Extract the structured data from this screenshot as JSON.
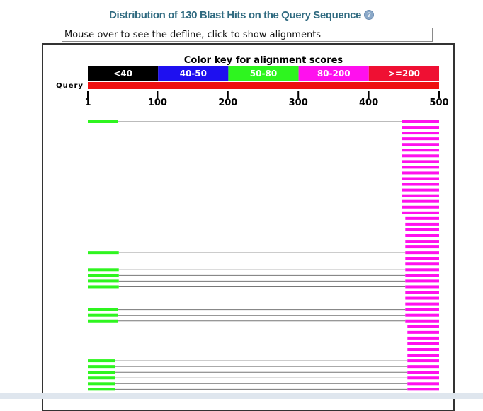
{
  "header": {
    "title": "Distribution of 130 Blast Hits on the Query Sequence",
    "help_icon": "question-circle-icon"
  },
  "defline": {
    "text": "Mouse over to see the defline, click to show alignments"
  },
  "chart_data": {
    "type": "alignment-graphic",
    "title": "Color key for alignment scores",
    "query_label": "Query",
    "query_range": [
      1,
      500
    ],
    "ticks": [
      "1",
      "100",
      "200",
      "300",
      "400",
      "500"
    ],
    "tick_values": [
      1,
      100,
      200,
      300,
      400,
      500
    ],
    "color_key": [
      {
        "label": "<40",
        "color": "#000000"
      },
      {
        "label": "40-50",
        "color": "#1e10f0"
      },
      {
        "label": "50-80",
        "color": "#2ef51f"
      },
      {
        "label": "80-200",
        "color": "#ff10ee"
      },
      {
        "label": ">=200",
        "color": "#ef1033"
      }
    ],
    "query_bar_color": "#ee1010",
    "connector_color": "#777777",
    "hits": [
      {
        "segments": [
          [
            1,
            44,
            "50-80"
          ],
          [
            447,
            500,
            "80-200"
          ]
        ]
      },
      {
        "segments": [
          [
            447,
            500,
            "80-200"
          ]
        ]
      },
      {
        "segments": [
          [
            447,
            500,
            "80-200"
          ]
        ]
      },
      {
        "segments": [
          [
            447,
            500,
            "80-200"
          ]
        ]
      },
      {
        "segments": [
          [
            447,
            500,
            "80-200"
          ]
        ]
      },
      {
        "segments": [
          [
            447,
            500,
            "80-200"
          ]
        ]
      },
      {
        "segments": [
          [
            447,
            500,
            "80-200"
          ]
        ]
      },
      {
        "segments": [
          [
            447,
            500,
            "80-200"
          ]
        ]
      },
      {
        "segments": [
          [
            447,
            500,
            "80-200"
          ]
        ]
      },
      {
        "segments": [
          [
            447,
            500,
            "80-200"
          ]
        ]
      },
      {
        "segments": [
          [
            447,
            500,
            "80-200"
          ]
        ]
      },
      {
        "segments": [
          [
            447,
            500,
            "80-200"
          ]
        ]
      },
      {
        "segments": [
          [
            447,
            500,
            "80-200"
          ]
        ]
      },
      {
        "segments": [
          [
            447,
            500,
            "80-200"
          ]
        ]
      },
      {
        "segments": [
          [
            447,
            500,
            "80-200"
          ]
        ]
      },
      {
        "segments": [
          [
            447,
            500,
            "80-200"
          ]
        ]
      },
      {
        "segments": [
          [
            447,
            500,
            "80-200"
          ]
        ]
      },
      {
        "segments": [
          [
            452,
            500,
            "80-200"
          ]
        ]
      },
      {
        "segments": [
          [
            452,
            500,
            "80-200"
          ]
        ]
      },
      {
        "segments": [
          [
            452,
            500,
            "80-200"
          ]
        ]
      },
      {
        "segments": [
          [
            452,
            500,
            "80-200"
          ]
        ]
      },
      {
        "segments": [
          [
            452,
            500,
            "80-200"
          ]
        ]
      },
      {
        "segments": [
          [
            452,
            500,
            "80-200"
          ]
        ]
      },
      {
        "segments": [
          [
            1,
            45,
            "50-80"
          ],
          [
            452,
            500,
            "80-200"
          ]
        ]
      },
      {
        "segments": [
          [
            452,
            500,
            "80-200"
          ]
        ]
      },
      {
        "segments": [
          [
            452,
            500,
            "80-200"
          ]
        ]
      },
      {
        "segments": [
          [
            1,
            45,
            "50-80"
          ],
          [
            452,
            500,
            "80-200"
          ]
        ]
      },
      {
        "segments": [
          [
            1,
            45,
            "50-80"
          ],
          [
            452,
            500,
            "80-200"
          ]
        ]
      },
      {
        "segments": [
          [
            1,
            45,
            "50-80"
          ],
          [
            452,
            500,
            "80-200"
          ]
        ]
      },
      {
        "segments": [
          [
            1,
            45,
            "50-80"
          ],
          [
            452,
            500,
            "80-200"
          ]
        ]
      },
      {
        "segments": [
          [
            452,
            500,
            "80-200"
          ]
        ]
      },
      {
        "segments": [
          [
            452,
            500,
            "80-200"
          ]
        ]
      },
      {
        "segments": [
          [
            452,
            500,
            "80-200"
          ]
        ]
      },
      {
        "segments": [
          [
            1,
            44,
            "50-80"
          ],
          [
            452,
            500,
            "80-200"
          ]
        ]
      },
      {
        "segments": [
          [
            1,
            44,
            "50-80"
          ],
          [
            452,
            500,
            "80-200"
          ]
        ]
      },
      {
        "segments": [
          [
            1,
            44,
            "50-80"
          ],
          [
            452,
            500,
            "80-200"
          ]
        ]
      },
      {
        "segments": [
          [
            455,
            500,
            "80-200"
          ]
        ]
      },
      {
        "segments": [
          [
            455,
            500,
            "80-200"
          ]
        ]
      },
      {
        "segments": [
          [
            455,
            500,
            "80-200"
          ]
        ]
      },
      {
        "segments": [
          [
            455,
            500,
            "80-200"
          ]
        ]
      },
      {
        "segments": [
          [
            455,
            500,
            "80-200"
          ]
        ]
      },
      {
        "segments": [
          [
            455,
            500,
            "80-200"
          ]
        ]
      },
      {
        "segments": [
          [
            1,
            40,
            "50-80"
          ],
          [
            455,
            500,
            "80-200"
          ]
        ]
      },
      {
        "segments": [
          [
            1,
            40,
            "50-80"
          ],
          [
            455,
            500,
            "80-200"
          ]
        ]
      },
      {
        "segments": [
          [
            1,
            40,
            "50-80"
          ],
          [
            455,
            500,
            "80-200"
          ]
        ]
      },
      {
        "segments": [
          [
            1,
            40,
            "50-80"
          ],
          [
            455,
            500,
            "80-200"
          ]
        ]
      },
      {
        "segments": [
          [
            1,
            40,
            "50-80"
          ],
          [
            455,
            500,
            "80-200"
          ]
        ]
      },
      {
        "segments": [
          [
            1,
            40,
            "50-80"
          ],
          [
            455,
            500,
            "80-200"
          ]
        ]
      }
    ]
  }
}
